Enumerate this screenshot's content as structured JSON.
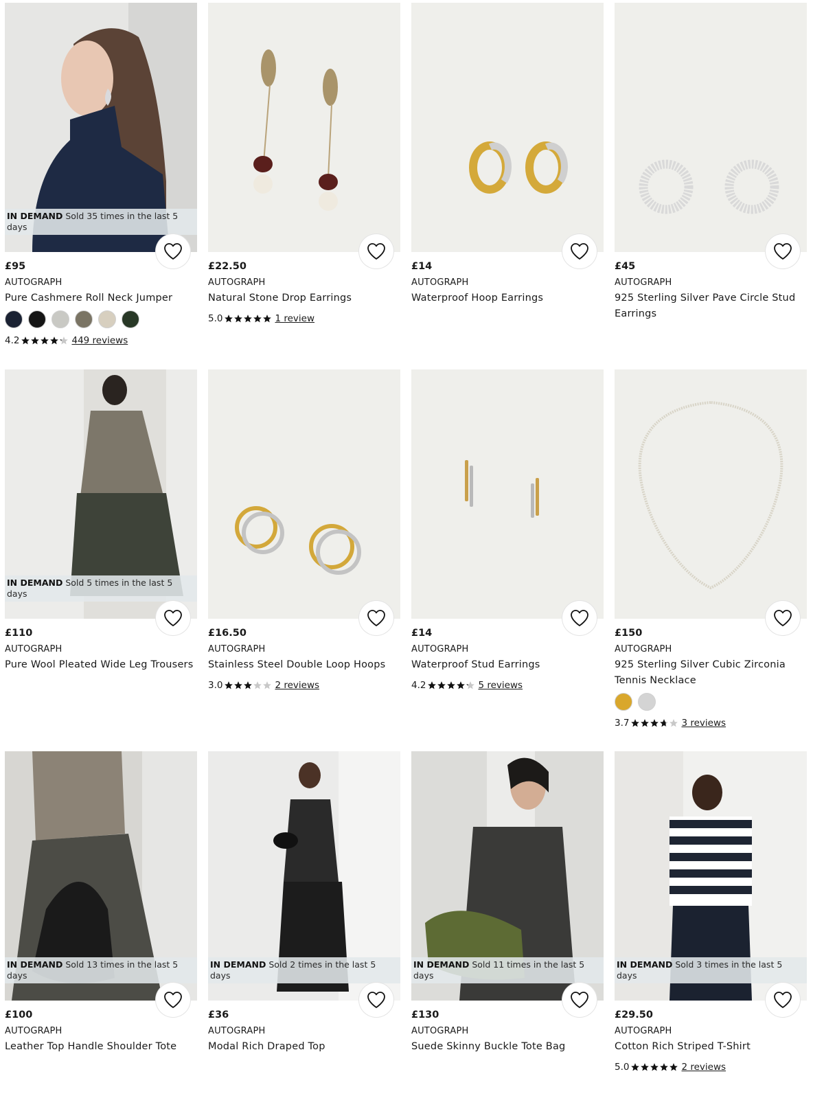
{
  "products": [
    {
      "price": "£95",
      "brand": "AUTOGRAPH",
      "name": "Pure Cashmere Roll Neck Jumper",
      "demand_label": "IN DEMAND",
      "demand_text": "Sold 35 times in the last 5 days",
      "rating": "4.2",
      "rating_value": 4.2,
      "reviews": "449 reviews",
      "swatches": [
        "#1b2233",
        "#151515",
        "#c9c9c4",
        "#7a7464",
        "#d7cfbf",
        "#283826"
      ],
      "image": "model-jumper"
    },
    {
      "price": "£22.50",
      "brand": "AUTOGRAPH",
      "name": "Natural Stone Drop Earrings",
      "rating": "5.0",
      "rating_value": 5.0,
      "reviews": "1 review",
      "image": "drop-earrings"
    },
    {
      "price": "£14",
      "brand": "AUTOGRAPH",
      "name": "Waterproof Hoop Earrings",
      "image": "hoop-earrings"
    },
    {
      "price": "£45",
      "brand": "AUTOGRAPH",
      "name": "925 Sterling Silver Pave Circle Stud Earrings",
      "image": "circle-stud"
    },
    {
      "price": "£110",
      "brand": "AUTOGRAPH",
      "name": "Pure Wool Pleated Wide Leg Trousers",
      "demand_label": "IN DEMAND",
      "demand_text": "Sold 5 times in the last 5 days",
      "image": "model-trousers"
    },
    {
      "price": "£16.50",
      "brand": "AUTOGRAPH",
      "name": "Stainless Steel Double Loop Hoops",
      "rating": "3.0",
      "rating_value": 3.0,
      "reviews": "2 reviews",
      "image": "double-loop"
    },
    {
      "price": "£14",
      "brand": "AUTOGRAPH",
      "name": "Waterproof Stud Earrings",
      "rating": "4.2",
      "rating_value": 4.2,
      "reviews": "5 reviews",
      "image": "bar-studs"
    },
    {
      "price": "£150",
      "brand": "AUTOGRAPH",
      "name": "925 Sterling Silver Cubic Zirconia Tennis Necklace",
      "rating": "3.7",
      "rating_value": 3.7,
      "reviews": "3 reviews",
      "swatches": [
        "#d9a72c",
        "#d4d4d4"
      ],
      "image": "tennis-necklace"
    },
    {
      "price": "£100",
      "brand": "AUTOGRAPH",
      "name": "Leather Top Handle Shoulder Tote",
      "demand_label": "IN DEMAND",
      "demand_text": "Sold 13 times in the last 5 days",
      "image": "model-tote"
    },
    {
      "price": "£36",
      "brand": "AUTOGRAPH",
      "name": "Modal Rich Draped Top",
      "demand_label": "IN DEMAND",
      "demand_text": "Sold 2 times in the last 5 days",
      "image": "model-draped-top"
    },
    {
      "price": "£130",
      "brand": "AUTOGRAPH",
      "name": "Suede Skinny Buckle Tote Bag",
      "demand_label": "IN DEMAND",
      "demand_text": "Sold 11 times in the last 5 days",
      "image": "model-suede-bag"
    },
    {
      "price": "£29.50",
      "brand": "AUTOGRAPH",
      "name": "Cotton Rich Striped T-Shirt",
      "demand_label": "IN DEMAND",
      "demand_text": "Sold 3 times in the last 5 days",
      "rating": "5.0",
      "rating_value": 5.0,
      "reviews": "2 reviews",
      "image": "model-striped-tee"
    }
  ]
}
